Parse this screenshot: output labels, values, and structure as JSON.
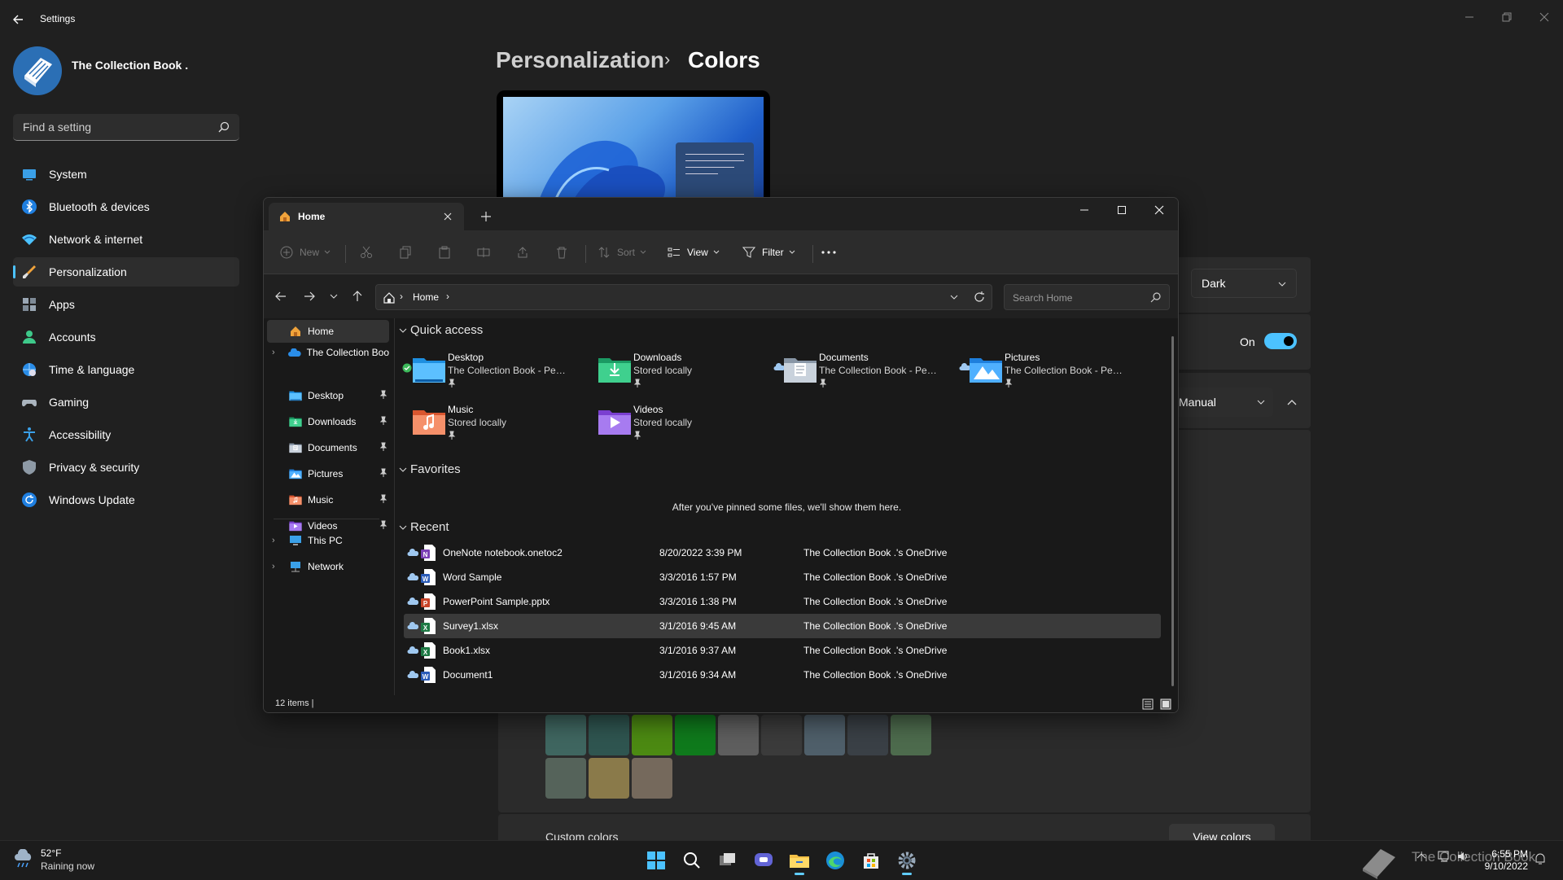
{
  "app": {
    "title": "Settings",
    "profile_name": "The Collection Book ."
  },
  "search": {
    "placeholder": "Find a setting"
  },
  "nav": {
    "items": [
      {
        "label": "System",
        "icon": "system-icon"
      },
      {
        "label": "Bluetooth & devices",
        "icon": "bluetooth-icon"
      },
      {
        "label": "Network & internet",
        "icon": "wifi-icon"
      },
      {
        "label": "Personalization",
        "icon": "brush-icon",
        "selected": true
      },
      {
        "label": "Apps",
        "icon": "apps-icon"
      },
      {
        "label": "Accounts",
        "icon": "person-icon"
      },
      {
        "label": "Time & language",
        "icon": "globe-clock-icon"
      },
      {
        "label": "Gaming",
        "icon": "gamepad-icon"
      },
      {
        "label": "Accessibility",
        "icon": "accessibility-icon"
      },
      {
        "label": "Privacy & security",
        "icon": "shield-icon"
      },
      {
        "label": "Windows Update",
        "icon": "update-icon"
      }
    ]
  },
  "breadcrumb": {
    "parent": "Personalization",
    "separator": "›",
    "current": "Colors"
  },
  "colors": {
    "mode_value": "Dark",
    "transparency_label": "On",
    "transparency_on": true,
    "accent_value": "Manual",
    "swatches_row1": [
      "#3f6660",
      "#2f5550",
      "#4c8a12",
      "#0f7a1c",
      "#5e5e5e",
      "#3b3b3b",
      "#4f5f6a",
      "#3a4046",
      "#4d6b4d"
    ],
    "swatches_row2": [
      "#55635a",
      "#8a7a4a",
      "#75695c"
    ],
    "custom_label": "Custom colors",
    "view_colors_label": "View colors",
    "accent_color": "#4cc2ff"
  },
  "explorer": {
    "tab_label": "Home",
    "toolbar": {
      "new_label": "New",
      "sort_label": "Sort",
      "view_label": "View",
      "filter_label": "Filter"
    },
    "address": {
      "crumb": "Home"
    },
    "search_placeholder": "Search Home",
    "tree": {
      "home": "Home",
      "onedrive": "The Collection Boo",
      "pinned": [
        {
          "label": "Desktop",
          "icon": "desktop-folder-icon",
          "color": "#2ea1e8"
        },
        {
          "label": "Downloads",
          "icon": "downloads-folder-icon",
          "color": "#27a86e"
        },
        {
          "label": "Documents",
          "icon": "documents-folder-icon",
          "color": "#8896a6"
        },
        {
          "label": "Pictures",
          "icon": "pictures-folder-icon",
          "color": "#2b8fe6"
        },
        {
          "label": "Music",
          "icon": "music-folder-icon",
          "color": "#e0673f"
        },
        {
          "label": "Videos",
          "icon": "videos-folder-icon",
          "color": "#8a4fd6"
        }
      ],
      "this_pc": "This PC",
      "network": "Network"
    },
    "sections": {
      "quick_access": "Quick access",
      "favorites": "Favorites",
      "recent": "Recent"
    },
    "quick_access": [
      {
        "name": "Desktop",
        "sub": "The Collection Book - Per...",
        "status": "synced",
        "icon": "desktop-folder-icon"
      },
      {
        "name": "Downloads",
        "sub": "Stored locally",
        "status": "",
        "icon": "downloads-folder-icon"
      },
      {
        "name": "Documents",
        "sub": "The Collection Book - Per...",
        "status": "cloud",
        "icon": "documents-folder-icon"
      },
      {
        "name": "Pictures",
        "sub": "The Collection Book - Per...",
        "status": "cloud",
        "icon": "pictures-folder-icon"
      },
      {
        "name": "Music",
        "sub": "Stored locally",
        "status": "",
        "icon": "music-folder-icon"
      },
      {
        "name": "Videos",
        "sub": "Stored locally",
        "status": "",
        "icon": "videos-folder-icon"
      }
    ],
    "favorites_empty": "After you've pinned some files, we'll show them here.",
    "recent": [
      {
        "name": "OneNote notebook.onetoc2",
        "date": "8/20/2022 3:39 PM",
        "location": "The Collection Book .'s OneDrive",
        "type": "onenote",
        "color": "#7b3fb5",
        "letter": "N"
      },
      {
        "name": "Word Sample",
        "date": "3/3/2016 1:57 PM",
        "location": "The Collection Book .'s OneDrive",
        "type": "word",
        "color": "#2b5cb8",
        "letter": "W"
      },
      {
        "name": "PowerPoint Sample.pptx",
        "date": "3/3/2016 1:38 PM",
        "location": "The Collection Book .'s OneDrive",
        "type": "powerpoint",
        "color": "#c8452a",
        "letter": "P"
      },
      {
        "name": "Survey1.xlsx",
        "date": "3/1/2016 9:45 AM",
        "location": "The Collection Book .'s OneDrive",
        "type": "excel",
        "color": "#1f7a45",
        "letter": "X",
        "selected": true
      },
      {
        "name": "Book1.xlsx",
        "date": "3/1/2016 9:37 AM",
        "location": "The Collection Book .'s OneDrive",
        "type": "excel",
        "color": "#1f7a45",
        "letter": "X"
      },
      {
        "name": "Document1",
        "date": "3/1/2016 9:34 AM",
        "location": "The Collection Book .'s OneDrive",
        "type": "word",
        "color": "#2b5cb8",
        "letter": "W"
      }
    ],
    "status_text": "12 items  |"
  },
  "taskbar": {
    "weather_temp": "52°F",
    "weather_cond": "Raining now",
    "apps": [
      "start-icon",
      "search-icon",
      "task-view-icon",
      "teams-chat-icon",
      "file-explorer-icon",
      "edge-icon",
      "store-icon",
      "settings-gear-icon"
    ],
    "time": "6:55 PM",
    "date": "9/10/2022",
    "watermark": "The Collection Book"
  }
}
